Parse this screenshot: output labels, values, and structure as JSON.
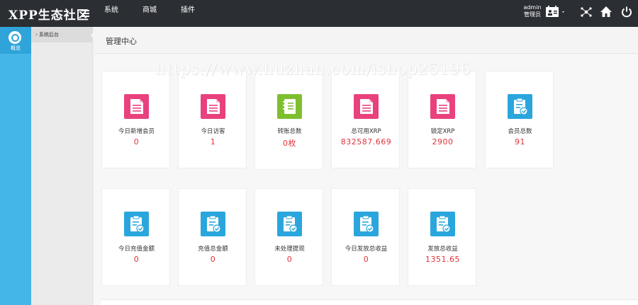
{
  "app": {
    "brand": "XPP生态社区"
  },
  "topnav": [
    {
      "label": "系统"
    },
    {
      "label": "商城"
    },
    {
      "label": "插件"
    }
  ],
  "user": {
    "name": "admin",
    "role": "管理员"
  },
  "rail": {
    "item_label": "概览"
  },
  "subnav": {
    "item_label": "系统后台"
  },
  "page": {
    "title": "管理中心"
  },
  "watermark": "https://www.huzhan.com/ishop25196",
  "colors": {
    "pink": "#e8417e",
    "green": "#7fbf2f",
    "blue": "#2aa6dc",
    "value_red": "#e0343b",
    "rail": "#45b6e8",
    "topbar": "#2b2e33"
  },
  "cards_row1": [
    {
      "label": "今日新增会员",
      "value": "0",
      "icon": "document-icon",
      "color": "#e8417e"
    },
    {
      "label": "今日访客",
      "value": "1",
      "icon": "document-icon",
      "color": "#e8417e"
    },
    {
      "label": "转账总数",
      "value": "0枚",
      "icon": "notebook-icon",
      "color": "#7fbf2f"
    },
    {
      "label": "总可用XRP",
      "value": "832587.669",
      "icon": "document-icon",
      "color": "#e8417e"
    },
    {
      "label": "锁定XRP",
      "value": "2900",
      "icon": "document-icon",
      "color": "#e8417e"
    },
    {
      "label": "会员总数",
      "value": "91",
      "icon": "clipboard-check-icon",
      "color": "#2aa6dc"
    }
  ],
  "cards_row2": [
    {
      "label": "今日充值金额",
      "value": "0",
      "icon": "clipboard-check-icon",
      "color": "#2aa6dc"
    },
    {
      "label": "充值总金额",
      "value": "0",
      "icon": "clipboard-check-icon",
      "color": "#2aa6dc"
    },
    {
      "label": "未处理提现",
      "value": "0",
      "icon": "clipboard-check-icon",
      "color": "#2aa6dc"
    },
    {
      "label": "今日发放总收益",
      "value": "0",
      "icon": "clipboard-check-icon",
      "color": "#2aa6dc"
    },
    {
      "label": "发放总收益",
      "value": "1351.65",
      "icon": "clipboard-check-icon",
      "color": "#2aa6dc"
    }
  ]
}
